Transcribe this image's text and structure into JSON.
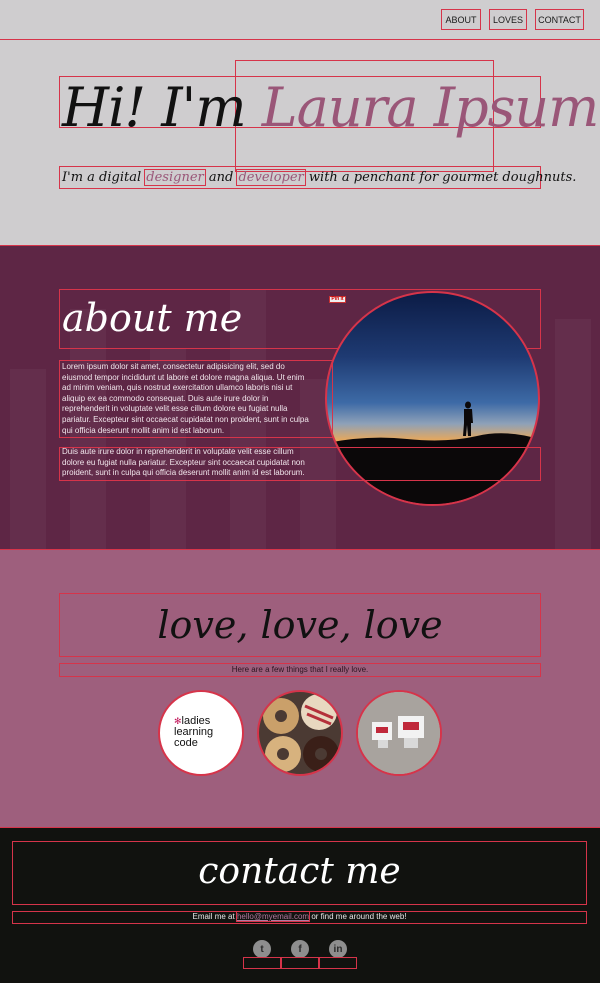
{
  "nav": {
    "about_label": "ABOUT",
    "loves_label": "LOVES",
    "contact_label": "CONTACT"
  },
  "hero": {
    "greeting": "Hi! I'm",
    "name": "Laura Ipsum",
    "period": ".",
    "sub_prefix": "I'm a digital",
    "sub_word1": "designer",
    "sub_and": "and",
    "sub_word2": "developer",
    "sub_suffix": "with a penchant for gourmet doughnuts."
  },
  "about": {
    "title": "about me",
    "pin_label": "Pin it",
    "paragraph1": "Lorem ipsum dolor sit amet, consectetur adipisicing elit, sed do eiusmod tempor incididunt ut labore et dolore magna aliqua. Ut enim ad minim veniam, quis nostrud exercitation ullamco laboris nisi ut aliquip ex ea commodo consequat. Duis aute irure dolor in reprehenderit in voluptate velit esse cillum dolore eu fugiat nulla pariatur. Excepteur sint occaecat cupidatat non proident, sunt in culpa qui officia deserunt mollit anim id est laborum.",
    "paragraph2": "Duis aute irure dolor in reprehenderit in voluptate velit esse cillum dolore eu fugiat nulla pariatur. Excepteur sint occaecat cupidatat non proident, sunt in culpa qui officia deserunt mollit anim id est laborum."
  },
  "loves": {
    "title": "love, love, love",
    "subtitle": "Here are a few things that I really love.",
    "ladies_mark": "✻",
    "ladies_line1": "ladies",
    "ladies_line2": "learning",
    "ladies_line3": "code"
  },
  "contact": {
    "title": "contact me",
    "line_prefix": "Email me at",
    "email": "hello@myemail.com",
    "line_suffix": "or find me around the web!",
    "twitter_glyph": "t",
    "facebook_glyph": "f",
    "linkedin_glyph": "in"
  },
  "colors": {
    "accent": "#9a5678",
    "about_bg": "#5e2645",
    "loves_bg": "#9e5f7d",
    "contact_bg": "#11120f",
    "outline": "#d6344a"
  }
}
